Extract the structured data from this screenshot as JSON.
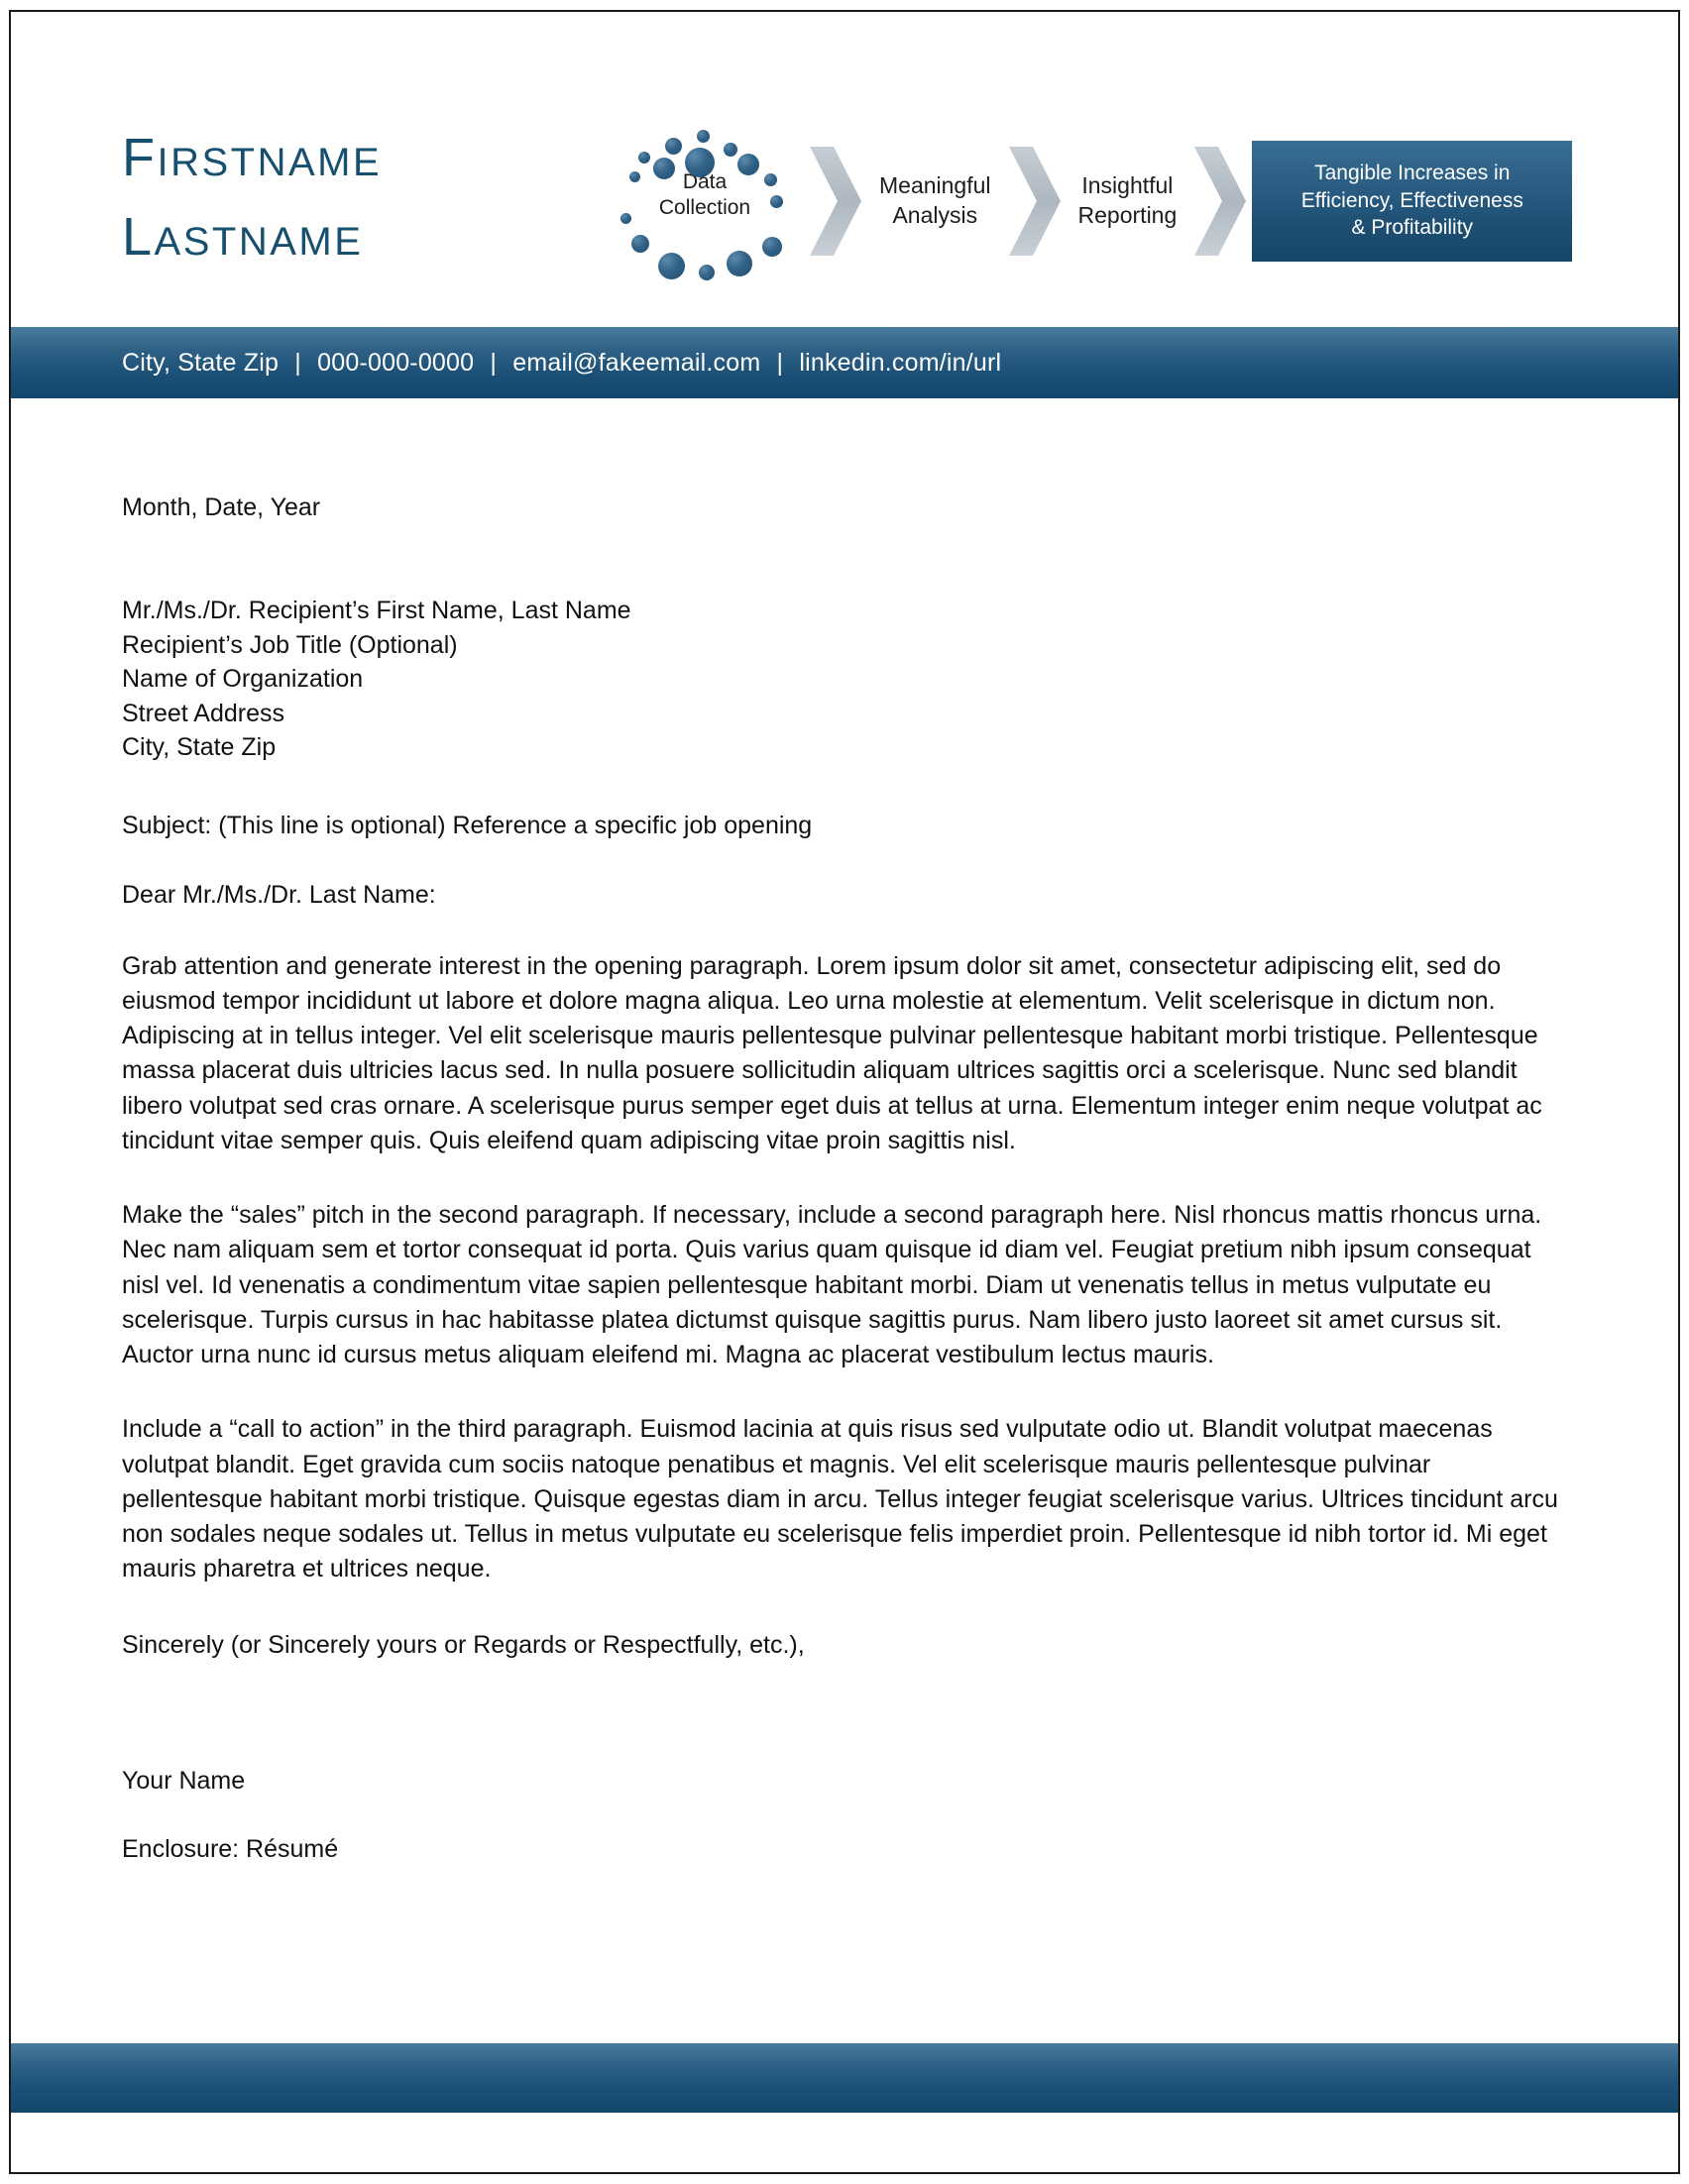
{
  "header": {
    "first_name": "FIRSTNAME",
    "last_name": "LASTNAME",
    "graphic": {
      "ring_label_line1": "Data",
      "ring_label_line2": "Collection",
      "step2_line1": "Meaningful",
      "step2_line2": "Analysis",
      "step3_line1": "Insightful",
      "step3_line2": "Reporting",
      "result_line1": "Tangible Increases in",
      "result_line2": "Efficiency, Effectiveness",
      "result_line3": "& Profitability"
    }
  },
  "contact": {
    "location": "City, State Zip",
    "phone": "000-000-0000",
    "email": "email@fakeemail.com",
    "linkedin": "linkedin.com/in/url",
    "separator": "|"
  },
  "letter": {
    "date": "Month, Date, Year",
    "recipient": {
      "name": "Mr./Ms./Dr. Recipient’s First Name, Last Name",
      "job_title": "Recipient’s Job Title (Optional)",
      "organization": "Name of Organization",
      "street": "Street Address",
      "city_state_zip": "City, State Zip"
    },
    "subject": "Subject: (This line is optional) Reference a specific job opening",
    "salutation": "Dear Mr./Ms./Dr. Last Name:",
    "paragraph1": "Grab attention and generate interest in the opening paragraph. Lorem ipsum dolor sit amet, consectetur adipiscing elit, sed do eiusmod tempor incididunt ut labore et dolore magna aliqua. Leo urna molestie at elementum. Velit scelerisque in dictum non. Adipiscing at in tellus integer. Vel elit scelerisque mauris pellentesque pulvinar pellentesque habitant morbi tristique. Pellentesque massa placerat duis ultricies lacus sed. In nulla posuere sollicitudin aliquam ultrices sagittis orci a scelerisque. Nunc sed blandit libero volutpat sed cras ornare. A scelerisque purus semper eget duis at tellus at urna. Elementum integer enim neque volutpat ac tincidunt vitae semper quis. Quis eleifend quam adipiscing vitae proin sagittis nisl.",
    "paragraph2": "Make the “sales” pitch in the second paragraph. If necessary, include a second paragraph here. Nisl rhoncus mattis rhoncus urna. Nec nam aliquam sem et tortor consequat id porta. Quis varius quam quisque id diam vel. Feugiat pretium nibh ipsum consequat nisl vel. Id venenatis a condimentum vitae sapien pellentesque habitant morbi. Diam ut venenatis tellus in metus vulputate eu scelerisque. Turpis cursus in hac habitasse platea dictumst quisque sagittis purus. Nam libero justo laoreet sit amet cursus sit. Auctor urna nunc id cursus metus aliquam eleifend mi. Magna ac placerat vestibulum lectus mauris.",
    "paragraph3": "Include a “call to action” in the third paragraph. Euismod lacinia at quis risus sed vulputate odio ut. Blandit volutpat maecenas volutpat blandit. Eget gravida cum sociis natoque penatibus et magnis. Vel elit scelerisque mauris pellentesque pulvinar pellentesque habitant morbi tristique. Quisque egestas diam in arcu. Tellus integer feugiat scelerisque varius. Ultrices tincidunt arcu non sodales neque sodales ut. Tellus in metus vulputate eu scelerisque felis imperdiet proin. Pellentesque id nibh tortor id. Mi eget mauris pharetra et ultrices neque.",
    "closing": "Sincerely (or Sincerely yours or Regards or Respectfully, etc.),",
    "signature_name": "Your Name",
    "enclosure": "Enclosure: Résumé"
  },
  "colors": {
    "brand_blue": "#16506e",
    "bar_blue_top": "#4a7b9e",
    "bar_blue_bottom": "#12466b",
    "text": "#111111"
  }
}
